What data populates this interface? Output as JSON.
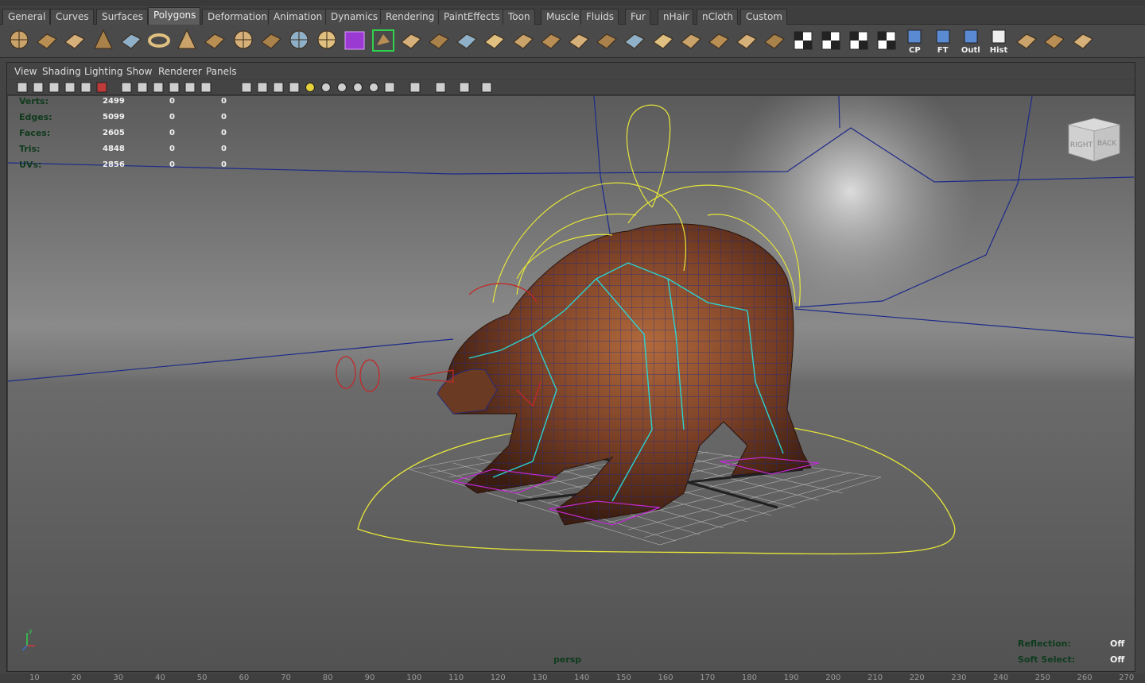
{
  "shelf_tabs": [
    {
      "label": "General",
      "active": false
    },
    {
      "label": "Curves",
      "active": false
    },
    {
      "label": "Surfaces",
      "active": false
    },
    {
      "label": "Polygons",
      "active": true
    },
    {
      "label": "Deformation",
      "active": false
    },
    {
      "label": "Animation",
      "active": false
    },
    {
      "label": "Dynamics",
      "active": false
    },
    {
      "label": "Rendering",
      "active": false
    },
    {
      "label": "PaintEffects",
      "active": false
    },
    {
      "label": "Toon",
      "active": false
    },
    {
      "label": "Muscle",
      "active": false
    },
    {
      "label": "Fluids",
      "active": false
    },
    {
      "label": "Fur",
      "active": false
    },
    {
      "label": "nHair",
      "active": false
    },
    {
      "label": "nCloth",
      "active": false
    },
    {
      "label": "Custom",
      "active": false
    }
  ],
  "shelf_buttons": [
    {
      "icon": "poly-sphere-icon",
      "label": ""
    },
    {
      "icon": "poly-cube-icon",
      "label": ""
    },
    {
      "icon": "poly-cylinder-icon",
      "label": ""
    },
    {
      "icon": "poly-cone-icon",
      "label": ""
    },
    {
      "icon": "poly-plane-icon",
      "label": ""
    },
    {
      "icon": "poly-torus-icon",
      "label": ""
    },
    {
      "icon": "poly-pyramid-icon",
      "label": ""
    },
    {
      "icon": "poly-pipe-icon",
      "label": ""
    },
    {
      "icon": "poly-soccerball-icon",
      "label": ""
    },
    {
      "icon": "separate-icon",
      "label": ""
    },
    {
      "icon": "combine-icon",
      "label": ""
    },
    {
      "icon": "smooth-icon",
      "label": ""
    },
    {
      "icon": "unfold-icon",
      "label": ""
    },
    {
      "icon": "bridge-icon",
      "label": ""
    },
    {
      "icon": "extrude-icon",
      "label": ""
    },
    {
      "icon": "bevel-icon",
      "label": ""
    },
    {
      "icon": "merge-icon",
      "label": ""
    },
    {
      "icon": "split-polygon-icon",
      "label": ""
    },
    {
      "icon": "insert-edge-loop-icon",
      "label": ""
    },
    {
      "icon": "append-polygon-icon",
      "label": ""
    },
    {
      "icon": "create-polygon-icon",
      "label": ""
    },
    {
      "icon": "fill-hole-icon",
      "label": ""
    },
    {
      "icon": "reduce-icon",
      "label": ""
    },
    {
      "icon": "cleanup-icon",
      "label": ""
    },
    {
      "icon": "wedge-icon",
      "label": ""
    },
    {
      "icon": "poke-icon",
      "label": ""
    },
    {
      "icon": "planar-mapping-icon",
      "label": ""
    },
    {
      "icon": "sculpt-icon",
      "label": ""
    },
    {
      "icon": "uv-editor-icon",
      "label": ""
    },
    {
      "icon": "checker-icon",
      "label": ""
    },
    {
      "icon": "uv-snapshot-icon",
      "label": ""
    },
    {
      "icon": "texture-icon",
      "label": ""
    },
    {
      "icon": "cp-icon",
      "label": "CP"
    },
    {
      "icon": "ft-icon",
      "label": "FT"
    },
    {
      "icon": "outliner-icon",
      "label": "Outl"
    },
    {
      "icon": "history-icon",
      "label": "Hist"
    },
    {
      "icon": "tool-a-icon",
      "label": ""
    },
    {
      "icon": "tool-b-icon",
      "label": ""
    },
    {
      "icon": "tool-c-icon",
      "label": ""
    }
  ],
  "panel_menu": [
    "View",
    "Shading",
    "Lighting",
    "Show",
    "Renderer",
    "Panels"
  ],
  "panel_tools": [
    "camera-icon",
    "camera-attr-icon",
    "bookmark-icon",
    "image-plane-icon",
    "lock-icon",
    "snapshot-icon",
    "grid-icon",
    "film-gate-icon",
    "resolution-gate-icon",
    "gate-mask-icon",
    "field-chart-icon",
    "safe-action-icon",
    "wireframe-icon",
    "smooth-shade-icon",
    "wire-on-shaded-icon",
    "textured-icon",
    "default-light-icon",
    "shadows-icon",
    "ambient-occlusion-icon",
    "motion-blur-icon",
    "antialias-icon",
    "hardware-fog-icon",
    "isolate-select-icon",
    "xray-icon",
    "xray-joints-icon",
    "share-icon"
  ],
  "hud": {
    "rows": [
      {
        "label": "Verts:",
        "values": [
          "2499",
          "0",
          "0"
        ]
      },
      {
        "label": "Edges:",
        "values": [
          "5099",
          "0",
          "0"
        ]
      },
      {
        "label": "Faces:",
        "values": [
          "2605",
          "0",
          "0"
        ]
      },
      {
        "label": "Tris:",
        "values": [
          "4848",
          "0",
          "0"
        ]
      },
      {
        "label": "UVs:",
        "values": [
          "2856",
          "0",
          "0"
        ]
      }
    ],
    "reflection_label": "Reflection:",
    "reflection_value": "Off",
    "soft_select_label": "Soft Select:",
    "soft_select_value": "Off",
    "camera": "persp"
  },
  "viewcube": {
    "right": "RIGHT",
    "back": "BACK"
  },
  "axis": {
    "y": "y",
    "x": "x",
    "z": "z"
  },
  "timeline": [
    "10",
    "20",
    "30",
    "40",
    "50",
    "60",
    "70",
    "80",
    "90",
    "100",
    "110",
    "120",
    "130",
    "140",
    "150",
    "160",
    "170",
    "180",
    "190",
    "200",
    "210",
    "220",
    "230",
    "240",
    "250",
    "260",
    "270"
  ],
  "colors": {
    "accent_green": "#2fd24a",
    "hud_label": "#0f3a1c",
    "wire_blue": "#1c2a8a",
    "rig_yellow": "#e6e63a",
    "rig_red": "#c02a2a",
    "rig_cyan": "#2ad2d2",
    "fur_brown": "#8a4e2c"
  }
}
